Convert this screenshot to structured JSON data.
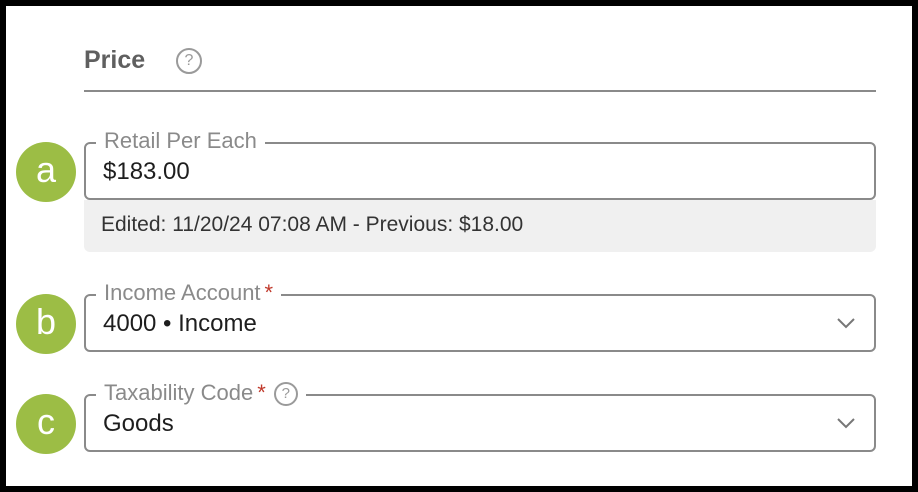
{
  "section": {
    "title": "Price",
    "help_glyph": "?"
  },
  "badges": {
    "a": "a",
    "b": "b",
    "c": "c"
  },
  "retail": {
    "label": "Retail Per Each",
    "value": "$183.00",
    "edit_note": "Edited: 11/20/24 07:08 AM - Previous: $18.00"
  },
  "income_account": {
    "label": "Income Account",
    "required_mark": "*",
    "value": "4000 • Income"
  },
  "taxability_code": {
    "label": "Taxability Code",
    "required_mark": "*",
    "help_glyph": "?",
    "value": "Goods"
  },
  "colors": {
    "badge": "#9cbd45",
    "required": "#c0392b",
    "border": "#8a8a8a"
  },
  "icons": {
    "help": "question-circle-icon",
    "dropdown": "chevron-down-icon"
  }
}
